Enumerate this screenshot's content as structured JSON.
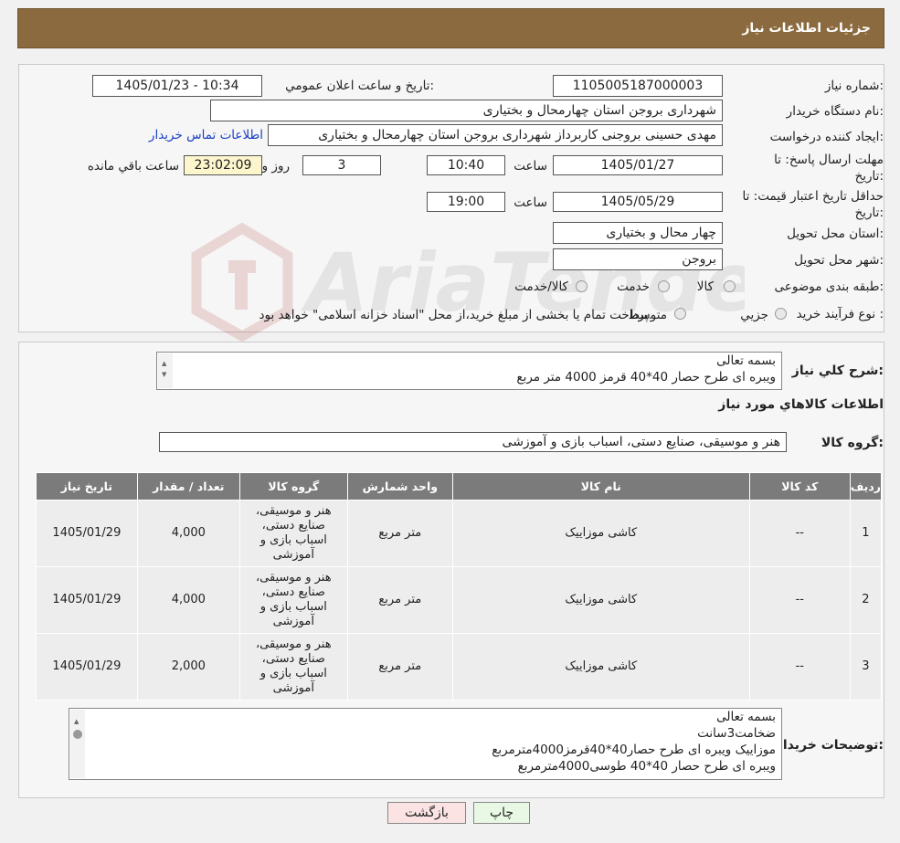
{
  "header": {
    "title": "جزئیات اطلاعات نیاز"
  },
  "watermark": {
    "text": "AriaTender.neT"
  },
  "fields": {
    "need_number_label": "شماره نیاز:",
    "need_number": "1105005187000003",
    "announce_label": "تاریخ و ساعت اعلان عمومي:",
    "announce_value": "1405/01/23 - 10:34",
    "buyer_org_label": "نام دستگاه خريدار:",
    "buyer_org": "شهرداری بروجن استان چهارمحال و بختیاری",
    "requester_label": "ايجاد کننده درخواست:",
    "requester": "مهدی حسینی بروجنی کاربرداز شهرداری بروجن استان چهارمحال و بختیاری",
    "contact_link": "اطلاعات تماس خريدار",
    "reply_deadline_label": "مهلت ارسال پاسخ: تا تاریخ:",
    "reply_date": "1405/01/27",
    "time_label": "ساعت",
    "reply_time": "10:40",
    "days_value": "3",
    "days_label": "روز و",
    "remaining_time": "23:02:09",
    "remaining_label": "ساعت باقي مانده",
    "validity_label": "حداقل تاريخ اعتبار قيمت: تا تاريخ:",
    "validity_date": "1405/05/29",
    "validity_time": "19:00",
    "province_label": "استان محل تحويل:",
    "province": "چهار محال و بختیاری",
    "city_label": "شهر محل تحويل:",
    "city": "بروجن",
    "category_label": "طبقه بندی موضوعی:",
    "category_options": [
      "کالا",
      "خدمت",
      "کالا/خدمت"
    ],
    "process_label": "نوع فرآيند خريد :",
    "process_options": [
      "جزيي",
      "متوسط"
    ],
    "process_note": "پرداخت تمام يا بخشی از مبلغ خريد،از محل \"اسناد خزانه اسلامی\" خواهد بود."
  },
  "description": {
    "label": "شرح کلي نياز:",
    "lines": [
      "بسمه تعالی",
      "ویبره ای طرح حصار 40*40 قرمز 4000 متر مربع"
    ]
  },
  "goods_section": {
    "title": "اطلاعات کالاهاي مورد نياز",
    "group_label": "گروه کالا:",
    "group_value": "هنر و موسیقی، صنایع دستی، اسباب بازی و آموزشی"
  },
  "table": {
    "headers": [
      "رديف",
      "کد کالا",
      "نام کالا",
      "واحد شمارش",
      "گروه کالا",
      "تعداد / مقدار",
      "تاريخ نياز"
    ],
    "rows": [
      {
        "idx": "1",
        "code": "--",
        "name": "کاشی موزاییک",
        "unit": "متر مربع",
        "group": "هنر و موسیقی، صنایع دستی، اسباب بازی و آموزشی",
        "qty": "4,000",
        "date": "1405/01/29"
      },
      {
        "idx": "2",
        "code": "--",
        "name": "کاشی موزاییک",
        "unit": "متر مربع",
        "group": "هنر و موسیقی، صنایع دستی، اسباب بازی و آموزشی",
        "qty": "4,000",
        "date": "1405/01/29"
      },
      {
        "idx": "3",
        "code": "--",
        "name": "کاشی موزاییک",
        "unit": "متر مربع",
        "group": "هنر و موسیقی، صنایع دستی، اسباب بازی و آموزشی",
        "qty": "2,000",
        "date": "1405/01/29"
      }
    ]
  },
  "buyer_notes": {
    "label": "توضيحات خريدار:",
    "lines": [
      "بسمه تعالی",
      "ضخامت3سانت",
      "موزاییک ویبره ای طرح حصار40*40قرمز4000مترمربع",
      "ویبره ای طرح حصار 40*40 طوسی4000مترمربع"
    ]
  },
  "buttons": {
    "print": "چاپ",
    "back": "بازگشت"
  },
  "colors": {
    "header_bg": "#8c6a3f",
    "table_header_bg": "#7b7b7b",
    "back_button_bg": "#fbe3e3",
    "print_button_bg": "#e9f8e4",
    "timer_bg": "#fdf6cc"
  }
}
